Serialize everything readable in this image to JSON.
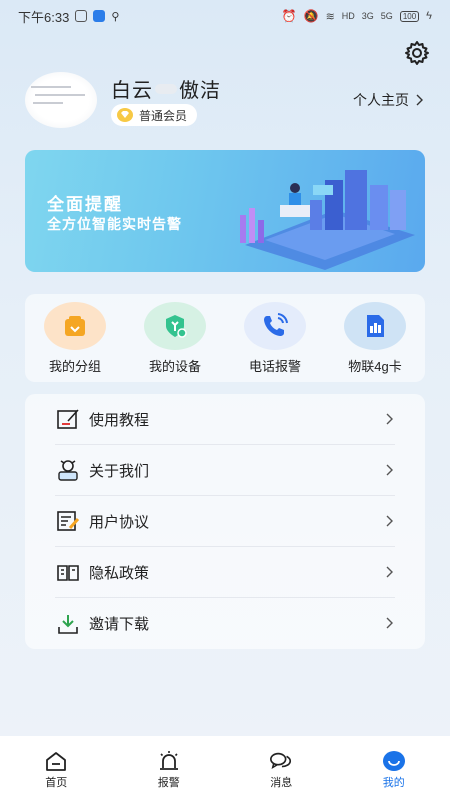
{
  "status_bar": {
    "time": "下午6:33",
    "battery": "100",
    "network_hd": "HD",
    "network_3g": "3G",
    "network_5g": "5G"
  },
  "profile": {
    "username_left": "白云",
    "username_right": "傲洁",
    "member_level": "普通会员",
    "home_link": "个人主页"
  },
  "banner": {
    "title": "全面提醒",
    "subtitle": "全方位智能实时告警"
  },
  "quick_actions": [
    {
      "label": "我的分组",
      "icon": "group-icon",
      "color": "#fde3c8"
    },
    {
      "label": "我的设备",
      "icon": "device-icon",
      "color": "#d6f1e4"
    },
    {
      "label": "电话报警",
      "icon": "phone-icon",
      "color": "#e4ecfb"
    },
    {
      "label": "物联4g卡",
      "icon": "sim-card-icon",
      "color": "#cfe3f5"
    }
  ],
  "menu": [
    {
      "label": "使用教程",
      "icon": "tutorial-icon"
    },
    {
      "label": "关于我们",
      "icon": "about-icon"
    },
    {
      "label": "用户协议",
      "icon": "agreement-icon"
    },
    {
      "label": "隐私政策",
      "icon": "privacy-icon"
    },
    {
      "label": "邀请下载",
      "icon": "download-icon"
    }
  ],
  "tabs": [
    {
      "label": "首页",
      "icon": "home-icon"
    },
    {
      "label": "报警",
      "icon": "alarm-icon"
    },
    {
      "label": "消息",
      "icon": "message-icon"
    },
    {
      "label": "我的",
      "icon": "profile-icon"
    }
  ],
  "colors": {
    "accent": "#1a73e8",
    "banner_start": "#7fd6ef",
    "banner_end": "#5aa9ee"
  }
}
